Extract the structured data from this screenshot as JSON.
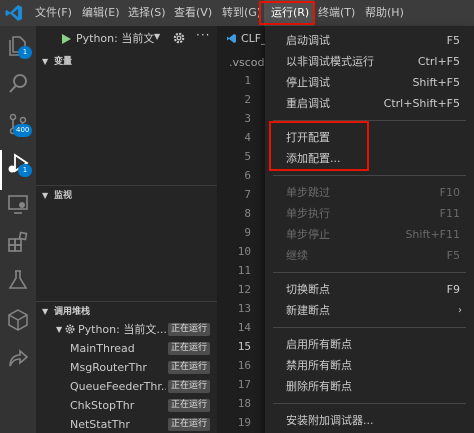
{
  "menubar": {
    "items": [
      "文件(F)",
      "编辑(E)",
      "选择(S)",
      "查看(V)",
      "转到(G)",
      "运行(R)",
      "终端(T)",
      "帮助(H)"
    ]
  },
  "activitybar": {
    "explorer_badge": "1",
    "scm_badge": "400",
    "debug_badge": "1"
  },
  "debug_panel": {
    "config_name": "Python: 当前文",
    "sections": {
      "variables": "变量",
      "watch": "监视",
      "callstack": "调用堆栈"
    },
    "callstack": {
      "session_name": "Python: 当前文...",
      "session_status": "正在运行",
      "threads": [
        {
          "name": "MainThread",
          "status": "正在运行"
        },
        {
          "name": "MsgRouterThr",
          "status": "正在运行"
        },
        {
          "name": "QueueFeederThr...",
          "status": "正在运行"
        },
        {
          "name": "ChkStopThr",
          "status": "正在运行"
        },
        {
          "name": "NetStatThr",
          "status": "正在运行"
        }
      ]
    }
  },
  "editor": {
    "tab_label": "CLF_",
    "breadcrumb": ".vscode",
    "line_numbers": [
      "1",
      "2",
      "3",
      "4",
      "5",
      "6",
      "7",
      "8",
      "9",
      "10",
      "11",
      "12",
      "13",
      "14",
      "15",
      "16",
      "17",
      "18",
      "19"
    ]
  },
  "run_menu": {
    "groups": [
      [
        {
          "label": "启动调试",
          "keys": "F5"
        },
        {
          "label": "以非调试模式运行",
          "keys": "Ctrl+F5"
        },
        {
          "label": "停止调试",
          "keys": "Shift+F5"
        },
        {
          "label": "重启调试",
          "keys": "Ctrl+Shift+F5"
        }
      ],
      [
        {
          "label": "打开配置",
          "keys": ""
        },
        {
          "label": "添加配置...",
          "keys": ""
        }
      ],
      [
        {
          "label": "单步跳过",
          "keys": "F10"
        },
        {
          "label": "单步执行",
          "keys": "F11"
        },
        {
          "label": "单步停止",
          "keys": "Shift+F11"
        },
        {
          "label": "继续",
          "keys": "F5"
        }
      ],
      [
        {
          "label": "切换断点",
          "keys": "F9"
        },
        {
          "label": "新建断点",
          "keys": ""
        }
      ],
      [
        {
          "label": "启用所有断点",
          "keys": ""
        },
        {
          "label": "禁用所有断点",
          "keys": ""
        },
        {
          "label": "删除所有断点",
          "keys": ""
        }
      ],
      [
        {
          "label": "安装附加调试器...",
          "keys": ""
        }
      ]
    ]
  },
  "colors": {
    "accent_blue": "#007acc",
    "highlight_red": "#e51400",
    "debug_green": "#89d185"
  }
}
